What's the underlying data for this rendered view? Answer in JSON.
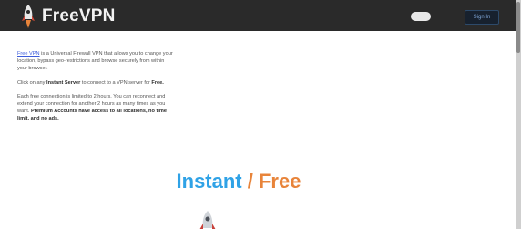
{
  "header": {
    "brand": "FreeVPN",
    "toggle_label": "",
    "signin_label": "Sign In"
  },
  "intro": {
    "p1": {
      "link": "Free VPN",
      "text": " is a Universal Firewall VPN that allows you to change your location, bypass geo-restrictions and browse securely from within your browser."
    },
    "p2": {
      "pre": "Click on any ",
      "bold1": "Instant Server",
      "mid": " to connect to a VPN server ",
      "post": "for ",
      "bold2": "Free."
    },
    "p3": {
      "text": "Each free connection is limited to 2 hours. You can reconnect and extend your connection for another 2 hours as many times as you want. ",
      "bold": "Premium Accounts have access to all locations, no time limit, and no ads."
    }
  },
  "hero": {
    "word1": "Instant",
    "sep": " / ",
    "word2": "Free"
  },
  "colors": {
    "topbar": "#2a2a2a",
    "instant": "#2fa2e6",
    "free": "#e8843a",
    "link": "#3b5bdb"
  }
}
